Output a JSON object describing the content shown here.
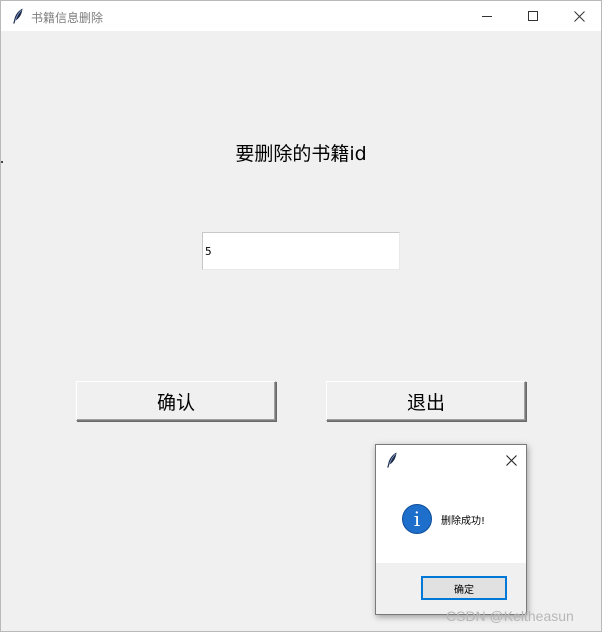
{
  "window": {
    "title": "书籍信息删除",
    "controls": [
      "minimize",
      "maximize",
      "close"
    ]
  },
  "form": {
    "heading": "要删除的书籍id",
    "id_value": "5",
    "confirm_label": "确认",
    "exit_label": "退出"
  },
  "dialog": {
    "icon": "info-icon",
    "message": "删除成功!",
    "ok_label": "确定"
  },
  "watermark": "CSDN @Keltheasun",
  "colors": {
    "accent": "#0078d7",
    "info_icon": "#1d6fcb",
    "background": "#f0f0f0"
  }
}
